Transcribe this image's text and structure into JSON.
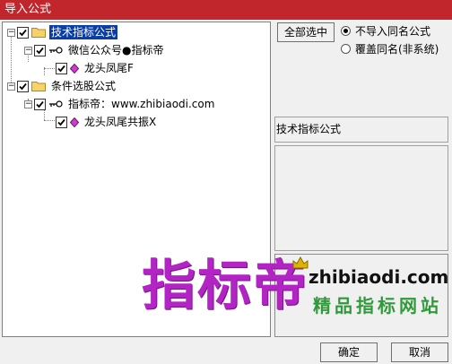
{
  "window": {
    "title": "导入公式"
  },
  "tree": {
    "nodes": [
      {
        "label": "技术指标公式"
      },
      {
        "label": "微信公众号●指标帝"
      },
      {
        "label": "龙头凤尾F"
      },
      {
        "label": "条件选股公式"
      },
      {
        "label": "指标帝：www.zhibiaodi.com"
      },
      {
        "label": "龙头凤尾共振X"
      }
    ]
  },
  "options": {
    "select_all_label": "全部选中",
    "radio1_label": "不导入同名公式",
    "radio2_label": "覆盖同名(非系统)"
  },
  "info": {
    "label": "技术指标公式"
  },
  "watermark": {
    "big_text": "指标帝",
    "url": "zhibiaodi.com",
    "sub": "精品指标网站"
  },
  "footer": {
    "ok_label": "确定",
    "cancel_label": "取消"
  }
}
